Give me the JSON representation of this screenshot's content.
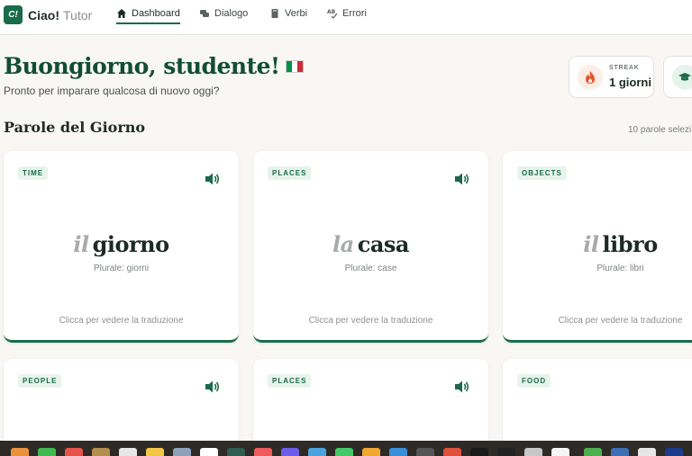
{
  "brand": {
    "logo": "C!",
    "name": "Ciao!",
    "sub": "Tutor"
  },
  "nav": [
    {
      "label": "Dashboard",
      "icon": "home-icon",
      "active": true
    },
    {
      "label": "Dialogo",
      "icon": "chat-icon"
    },
    {
      "label": "Verbi",
      "icon": "book-icon"
    },
    {
      "label": "Errori",
      "icon": "spellcheck-icon"
    }
  ],
  "greeting": {
    "title": "Buongiorno, studente!",
    "subtitle": "Pronto per imparare qualcosa di nuovo oggi?"
  },
  "stats": [
    {
      "label": "STREAK",
      "value": "1 giorni",
      "icon": "fire-icon"
    },
    {
      "label": "",
      "value": "",
      "icon": "graduation-cap-icon"
    }
  ],
  "section": {
    "title": "Parole del Giorno",
    "meta": "10 parole selezi"
  },
  "cards": [
    {
      "category": "TIME",
      "article": "il",
      "word": "giorno",
      "plural": "Plurale: giorni",
      "hint": "Clicca per vedere la traduzione"
    },
    {
      "category": "PLACES",
      "article": "la",
      "word": "casa",
      "plural": "Plurale: case",
      "hint": "Clicca per vedere la traduzione"
    },
    {
      "category": "OBJECTS",
      "article": "il",
      "word": "libro",
      "plural": "Plurale: libri",
      "hint": "Clicca per vedere la traduzione"
    },
    {
      "category": "PEOPLE"
    },
    {
      "category": "PLACES"
    },
    {
      "category": "FOOD"
    }
  ],
  "colors": {
    "primary": "#1a6b4a",
    "heading": "#124d36",
    "background": "#f8f7f4",
    "streak": "#e8552a"
  }
}
